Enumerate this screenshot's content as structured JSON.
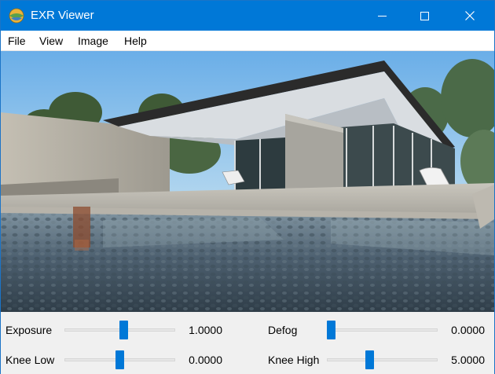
{
  "window": {
    "title": "EXR Viewer",
    "icon": "globe-app-icon",
    "controls": [
      "minimize-icon",
      "maximize-icon",
      "close-icon"
    ]
  },
  "menu": [
    {
      "label": "File"
    },
    {
      "label": "View"
    },
    {
      "label": "Image"
    },
    {
      "label": "Help"
    }
  ],
  "image_view": {
    "subject": "exr-render-modern-house-with-pool"
  },
  "sliders": {
    "exposure": {
      "label": "Exposure",
      "value": "1.0000",
      "position": 0.54
    },
    "defog": {
      "label": "Defog",
      "value": "0.0000",
      "position": 0.0
    },
    "knee_low": {
      "label": "Knee Low",
      "value": "0.0000",
      "position": 0.5
    },
    "knee_high": {
      "label": "Knee High",
      "value": "5.0000",
      "position": 0.38
    }
  },
  "colors": {
    "titlebar": "#0078d7",
    "slider_thumb": "#0078d7"
  }
}
